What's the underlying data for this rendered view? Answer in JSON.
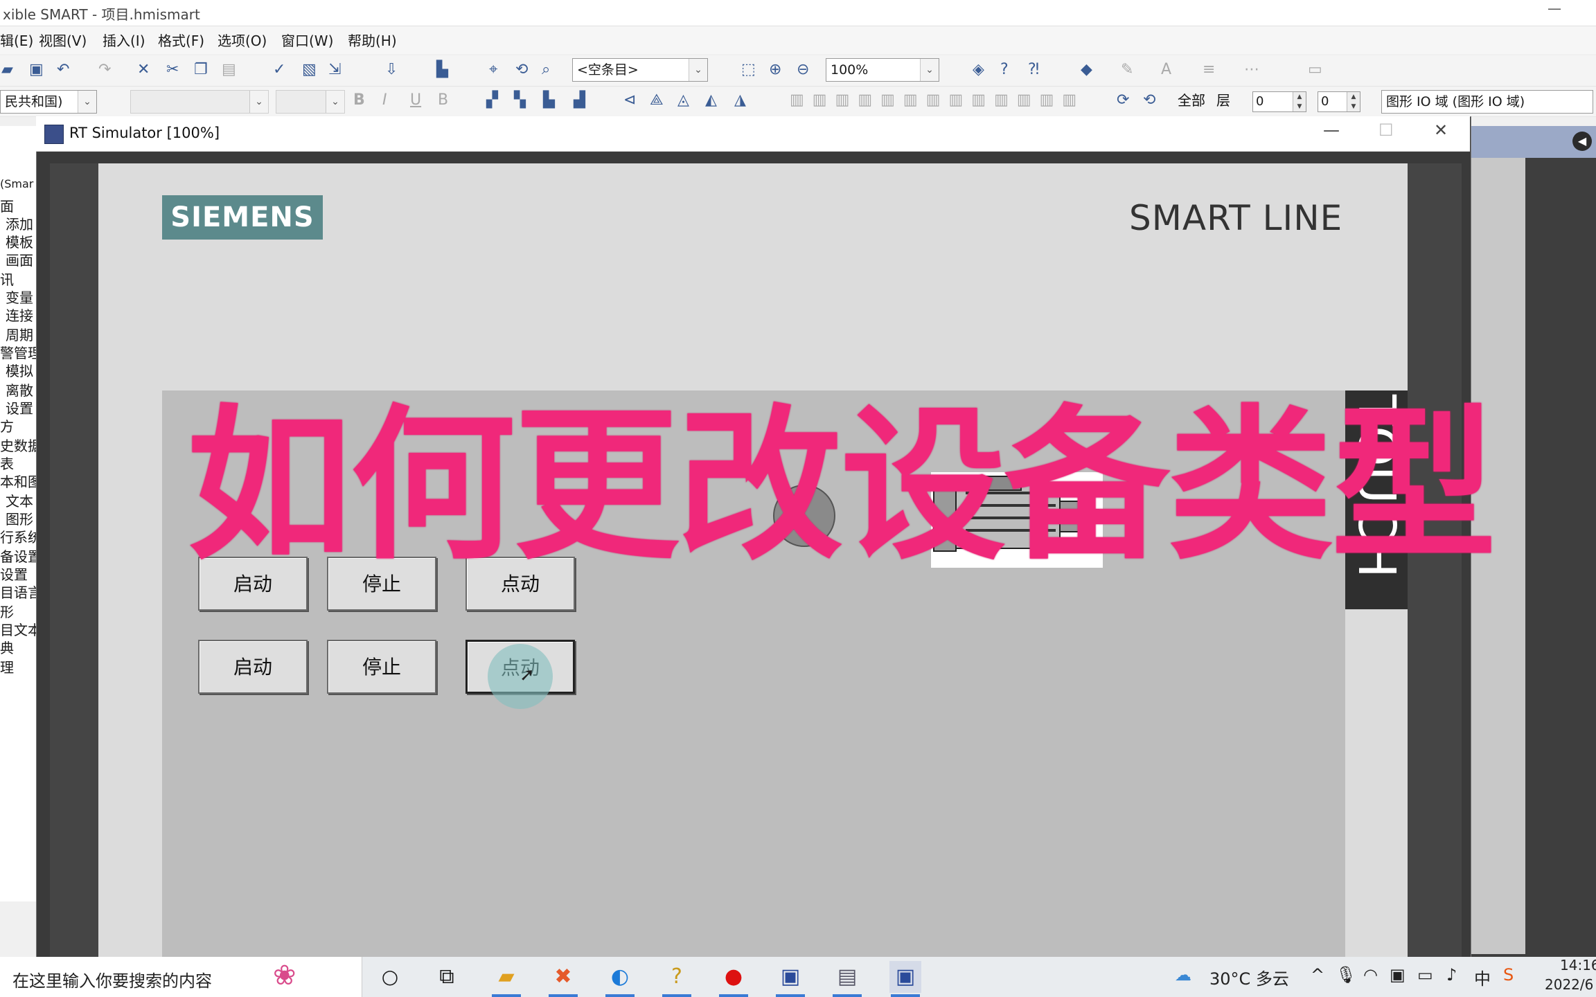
{
  "app": {
    "title": "xible SMART - 项目.hmismart",
    "minimize_glyph": "—"
  },
  "menu": [
    "辑(E)",
    "视图(V)",
    "插入(I)",
    "格式(F)",
    "选项(O)",
    "窗口(W)",
    "帮助(H)"
  ],
  "toolbar": {
    "object_combo": "<空条目>",
    "zoom_combo": "100%",
    "lang_combo": "民共和国)",
    "layer_label": "全部",
    "layer_menu": "层",
    "spin1": "0",
    "spin2": "0",
    "object_field": "图形 IO 域 (图形 IO 域)"
  },
  "tree": [
    "(Smar",
    "面",
    "添加",
    "模板",
    "画面",
    "讯",
    "变量",
    "连接",
    "周期",
    "警管理",
    "模拟",
    "离散",
    "设置",
    "方",
    "史数据",
    "表",
    "本和图",
    "文本",
    "图形",
    "行系统",
    "备设置",
    "设置",
    "目语言",
    "形",
    "目文本",
    "典",
    "理"
  ],
  "simulator": {
    "title": "RT Simulator [100%]",
    "minimize": "—",
    "maximize": "☐",
    "close": "✕"
  },
  "hmi": {
    "brand": "SIEMENS",
    "product_line": "SMART LINE",
    "touch_label": "TOUCH",
    "buttons_row1": [
      "启动",
      "停止",
      "点动"
    ],
    "buttons_row2": [
      "启动",
      "停止",
      "点动"
    ]
  },
  "overlay_caption": "如何更改设备类型",
  "taskbar": {
    "search_placeholder": "在这里输入你要搜索的内容",
    "weather": "30°C 多云",
    "ime": "中",
    "time": "14:16",
    "date": "2022/6"
  }
}
